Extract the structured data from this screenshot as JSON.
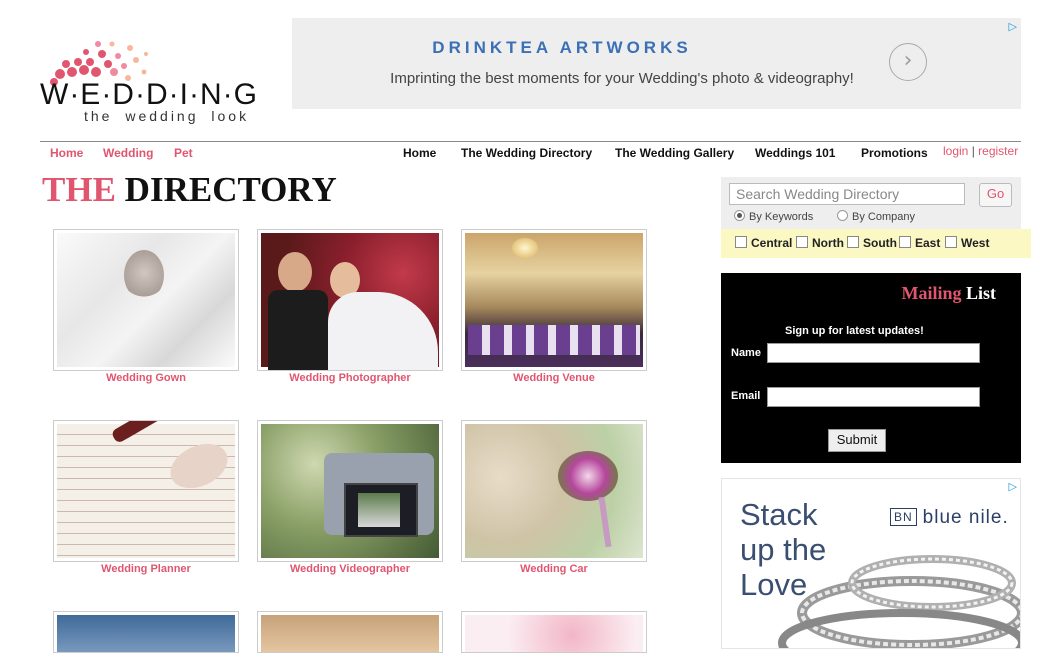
{
  "logo": {
    "word": "W·E·D·D·I·N·G",
    "tagline": "the wedding look"
  },
  "top_ad": {
    "title": "DRINKTEA ARTWORKS",
    "subtitle": "Imprinting the best moments for your Wedding's photo & videography!",
    "arrow": "›",
    "adchoice": "▷"
  },
  "nav_left": [
    "Home",
    "Wedding",
    "Pet"
  ],
  "nav_right": [
    "Home",
    "The Wedding Directory",
    "The Wedding Gallery",
    "Weddings 101",
    "Promotions"
  ],
  "auth": {
    "login": "login",
    "sep": "|",
    "register": "register"
  },
  "directory": {
    "title_a": "THE",
    "title_b": "DIRECTORY"
  },
  "grid": [
    {
      "label": "Wedding Gown"
    },
    {
      "label": "Wedding Photographer"
    },
    {
      "label": "Wedding Venue"
    },
    {
      "label": "Wedding Planner"
    },
    {
      "label": "Wedding Videographer"
    },
    {
      "label": "Wedding Car"
    }
  ],
  "search": {
    "placeholder": "Search Wedding Directory",
    "go": "Go",
    "options": [
      "By Keywords",
      "By Company"
    ],
    "selected": "By Keywords"
  },
  "regions": [
    "Central",
    "North",
    "South",
    "East",
    "West"
  ],
  "mailing": {
    "head_a": "Mailing",
    "head_b": "List",
    "signup": "Sign up for latest updates!",
    "name_label": "Name",
    "email_label": "Email",
    "submit": "Submit"
  },
  "side_ad": {
    "line1": "Stack",
    "line2": "up the",
    "line3": "Love",
    "brand": "blue nile.",
    "monogram": "BN",
    "adchoice": "▷"
  },
  "colors": {
    "accent": "#e0566f",
    "ad_blue": "#3b6fb6"
  }
}
